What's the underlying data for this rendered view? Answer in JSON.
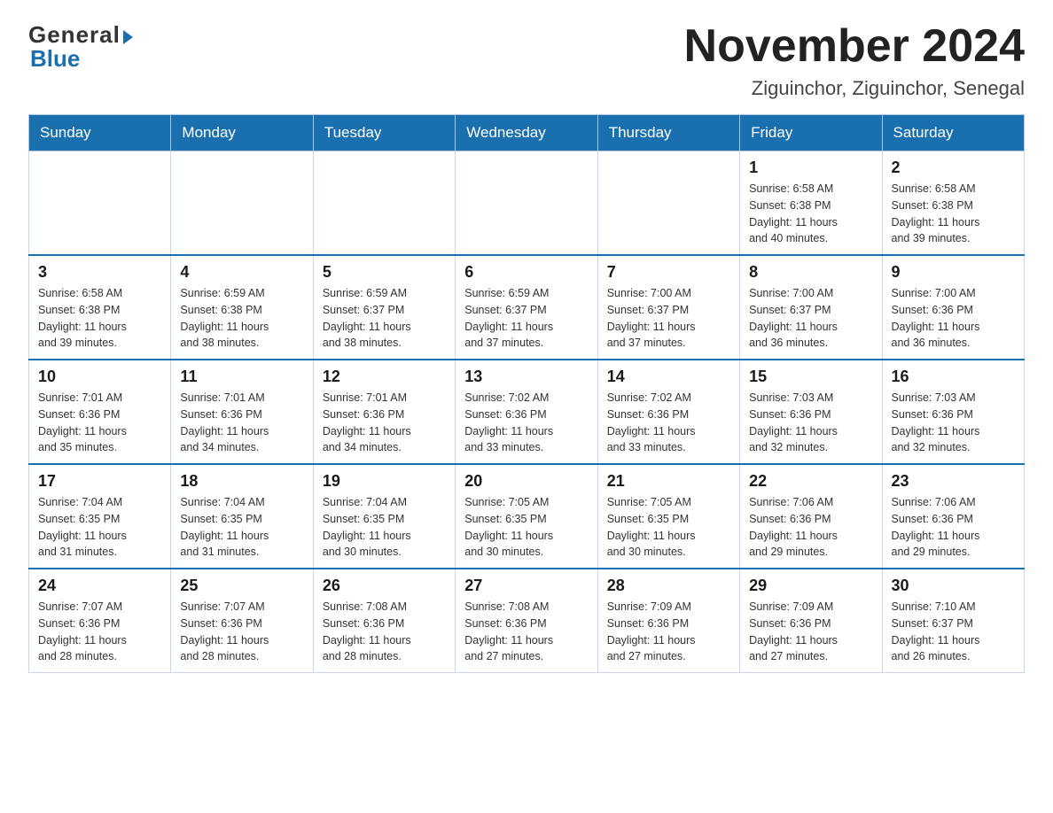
{
  "header": {
    "logo_general": "General",
    "logo_blue": "Blue",
    "title": "November 2024",
    "subtitle": "Ziguinchor, Ziguinchor, Senegal"
  },
  "weekdays": [
    "Sunday",
    "Monday",
    "Tuesday",
    "Wednesday",
    "Thursday",
    "Friday",
    "Saturday"
  ],
  "weeks": [
    [
      {
        "day": "",
        "info": ""
      },
      {
        "day": "",
        "info": ""
      },
      {
        "day": "",
        "info": ""
      },
      {
        "day": "",
        "info": ""
      },
      {
        "day": "",
        "info": ""
      },
      {
        "day": "1",
        "info": "Sunrise: 6:58 AM\nSunset: 6:38 PM\nDaylight: 11 hours\nand 40 minutes."
      },
      {
        "day": "2",
        "info": "Sunrise: 6:58 AM\nSunset: 6:38 PM\nDaylight: 11 hours\nand 39 minutes."
      }
    ],
    [
      {
        "day": "3",
        "info": "Sunrise: 6:58 AM\nSunset: 6:38 PM\nDaylight: 11 hours\nand 39 minutes."
      },
      {
        "day": "4",
        "info": "Sunrise: 6:59 AM\nSunset: 6:38 PM\nDaylight: 11 hours\nand 38 minutes."
      },
      {
        "day": "5",
        "info": "Sunrise: 6:59 AM\nSunset: 6:37 PM\nDaylight: 11 hours\nand 38 minutes."
      },
      {
        "day": "6",
        "info": "Sunrise: 6:59 AM\nSunset: 6:37 PM\nDaylight: 11 hours\nand 37 minutes."
      },
      {
        "day": "7",
        "info": "Sunrise: 7:00 AM\nSunset: 6:37 PM\nDaylight: 11 hours\nand 37 minutes."
      },
      {
        "day": "8",
        "info": "Sunrise: 7:00 AM\nSunset: 6:37 PM\nDaylight: 11 hours\nand 36 minutes."
      },
      {
        "day": "9",
        "info": "Sunrise: 7:00 AM\nSunset: 6:36 PM\nDaylight: 11 hours\nand 36 minutes."
      }
    ],
    [
      {
        "day": "10",
        "info": "Sunrise: 7:01 AM\nSunset: 6:36 PM\nDaylight: 11 hours\nand 35 minutes."
      },
      {
        "day": "11",
        "info": "Sunrise: 7:01 AM\nSunset: 6:36 PM\nDaylight: 11 hours\nand 34 minutes."
      },
      {
        "day": "12",
        "info": "Sunrise: 7:01 AM\nSunset: 6:36 PM\nDaylight: 11 hours\nand 34 minutes."
      },
      {
        "day": "13",
        "info": "Sunrise: 7:02 AM\nSunset: 6:36 PM\nDaylight: 11 hours\nand 33 minutes."
      },
      {
        "day": "14",
        "info": "Sunrise: 7:02 AM\nSunset: 6:36 PM\nDaylight: 11 hours\nand 33 minutes."
      },
      {
        "day": "15",
        "info": "Sunrise: 7:03 AM\nSunset: 6:36 PM\nDaylight: 11 hours\nand 32 minutes."
      },
      {
        "day": "16",
        "info": "Sunrise: 7:03 AM\nSunset: 6:36 PM\nDaylight: 11 hours\nand 32 minutes."
      }
    ],
    [
      {
        "day": "17",
        "info": "Sunrise: 7:04 AM\nSunset: 6:35 PM\nDaylight: 11 hours\nand 31 minutes."
      },
      {
        "day": "18",
        "info": "Sunrise: 7:04 AM\nSunset: 6:35 PM\nDaylight: 11 hours\nand 31 minutes."
      },
      {
        "day": "19",
        "info": "Sunrise: 7:04 AM\nSunset: 6:35 PM\nDaylight: 11 hours\nand 30 minutes."
      },
      {
        "day": "20",
        "info": "Sunrise: 7:05 AM\nSunset: 6:35 PM\nDaylight: 11 hours\nand 30 minutes."
      },
      {
        "day": "21",
        "info": "Sunrise: 7:05 AM\nSunset: 6:35 PM\nDaylight: 11 hours\nand 30 minutes."
      },
      {
        "day": "22",
        "info": "Sunrise: 7:06 AM\nSunset: 6:36 PM\nDaylight: 11 hours\nand 29 minutes."
      },
      {
        "day": "23",
        "info": "Sunrise: 7:06 AM\nSunset: 6:36 PM\nDaylight: 11 hours\nand 29 minutes."
      }
    ],
    [
      {
        "day": "24",
        "info": "Sunrise: 7:07 AM\nSunset: 6:36 PM\nDaylight: 11 hours\nand 28 minutes."
      },
      {
        "day": "25",
        "info": "Sunrise: 7:07 AM\nSunset: 6:36 PM\nDaylight: 11 hours\nand 28 minutes."
      },
      {
        "day": "26",
        "info": "Sunrise: 7:08 AM\nSunset: 6:36 PM\nDaylight: 11 hours\nand 28 minutes."
      },
      {
        "day": "27",
        "info": "Sunrise: 7:08 AM\nSunset: 6:36 PM\nDaylight: 11 hours\nand 27 minutes."
      },
      {
        "day": "28",
        "info": "Sunrise: 7:09 AM\nSunset: 6:36 PM\nDaylight: 11 hours\nand 27 minutes."
      },
      {
        "day": "29",
        "info": "Sunrise: 7:09 AM\nSunset: 6:36 PM\nDaylight: 11 hours\nand 27 minutes."
      },
      {
        "day": "30",
        "info": "Sunrise: 7:10 AM\nSunset: 6:37 PM\nDaylight: 11 hours\nand 26 minutes."
      }
    ]
  ]
}
